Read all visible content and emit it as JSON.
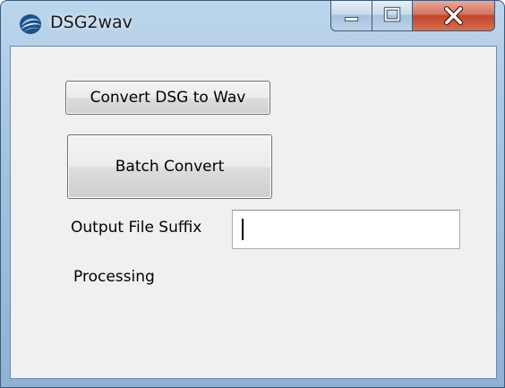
{
  "window": {
    "title": "DSG2wav",
    "icon": "app-swirl-icon",
    "controls": {
      "minimize_icon": "minimize-icon",
      "maximize_icon": "maximize-icon",
      "close_icon": "close-icon"
    }
  },
  "main": {
    "convert_button_label": "Convert DSG to Wav",
    "batch_button_label": "Batch Convert",
    "output_suffix_label": "Output File Suffix",
    "output_suffix_value": "",
    "status_text": "Processing"
  },
  "colors": {
    "frame": "#a9c6e2",
    "client_background": "#f0f0f0",
    "close_button": "#c2452b"
  }
}
